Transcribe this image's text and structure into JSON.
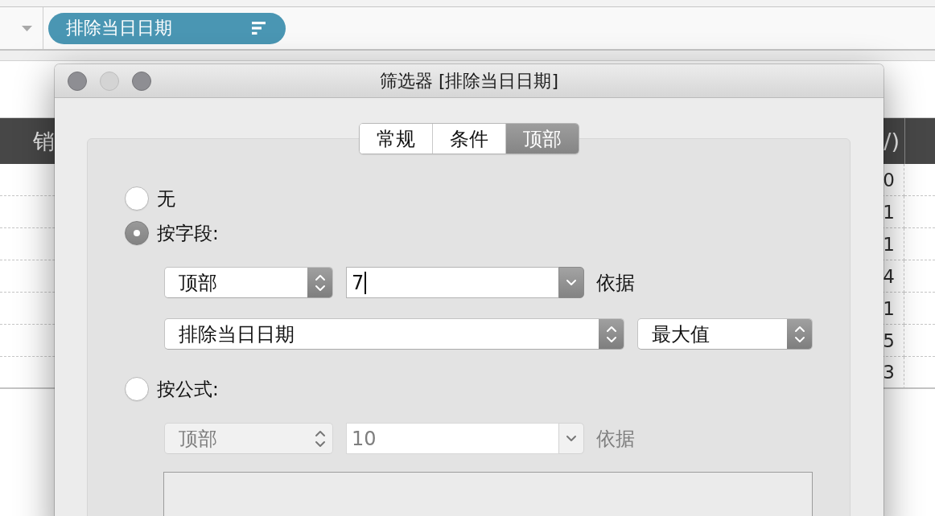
{
  "filter_shelf": {
    "pill_label": "排除当日日期"
  },
  "table": {
    "columns": [
      {
        "header": "销"
      },
      {
        "header": "/)"
      }
    ],
    "rows": [
      {
        "column_2": "0"
      },
      {
        "column_2": "1"
      },
      {
        "column_2": "1"
      },
      {
        "column_2": "4"
      },
      {
        "column_2": "1"
      },
      {
        "column_2": "5"
      },
      {
        "column_2": "3"
      }
    ]
  },
  "dialog": {
    "title": "筛选器 [排除当日日期]",
    "window_controls": [
      {
        "disabled": false
      },
      {
        "disabled": true
      },
      {
        "disabled": false
      }
    ],
    "tabs": [
      {
        "label": "常规",
        "selected": false
      },
      {
        "label": "条件",
        "selected": false
      },
      {
        "label": "顶部",
        "selected": true
      }
    ],
    "options": [
      {
        "label": "无",
        "selected": false
      },
      {
        "label": "按字段:",
        "selected": true,
        "rows": [
          {
            "items": [
              {
                "kind": "popup",
                "value": "顶部",
                "disabled": false
              },
              {
                "kind": "combo",
                "value": "7",
                "disabled": false,
                "focused": true
              },
              {
                "kind": "label",
                "text": "依据",
                "disabled": false
              }
            ]
          },
          {
            "items": [
              {
                "kind": "popup",
                "value": "排除当日日期",
                "disabled": false
              },
              {
                "kind": "popup",
                "value": "最大值",
                "disabled": false
              }
            ]
          }
        ]
      },
      {
        "label": "按公式:",
        "selected": false,
        "rows": [
          {
            "items": [
              {
                "kind": "popup",
                "value": "顶部",
                "disabled": true
              },
              {
                "kind": "combo",
                "value": "10",
                "disabled": true
              },
              {
                "kind": "label",
                "text": "依据",
                "disabled": true
              }
            ]
          },
          {
            "items": [
              {
                "kind": "text_area",
                "disabled": true
              }
            ]
          }
        ]
      }
    ]
  }
}
